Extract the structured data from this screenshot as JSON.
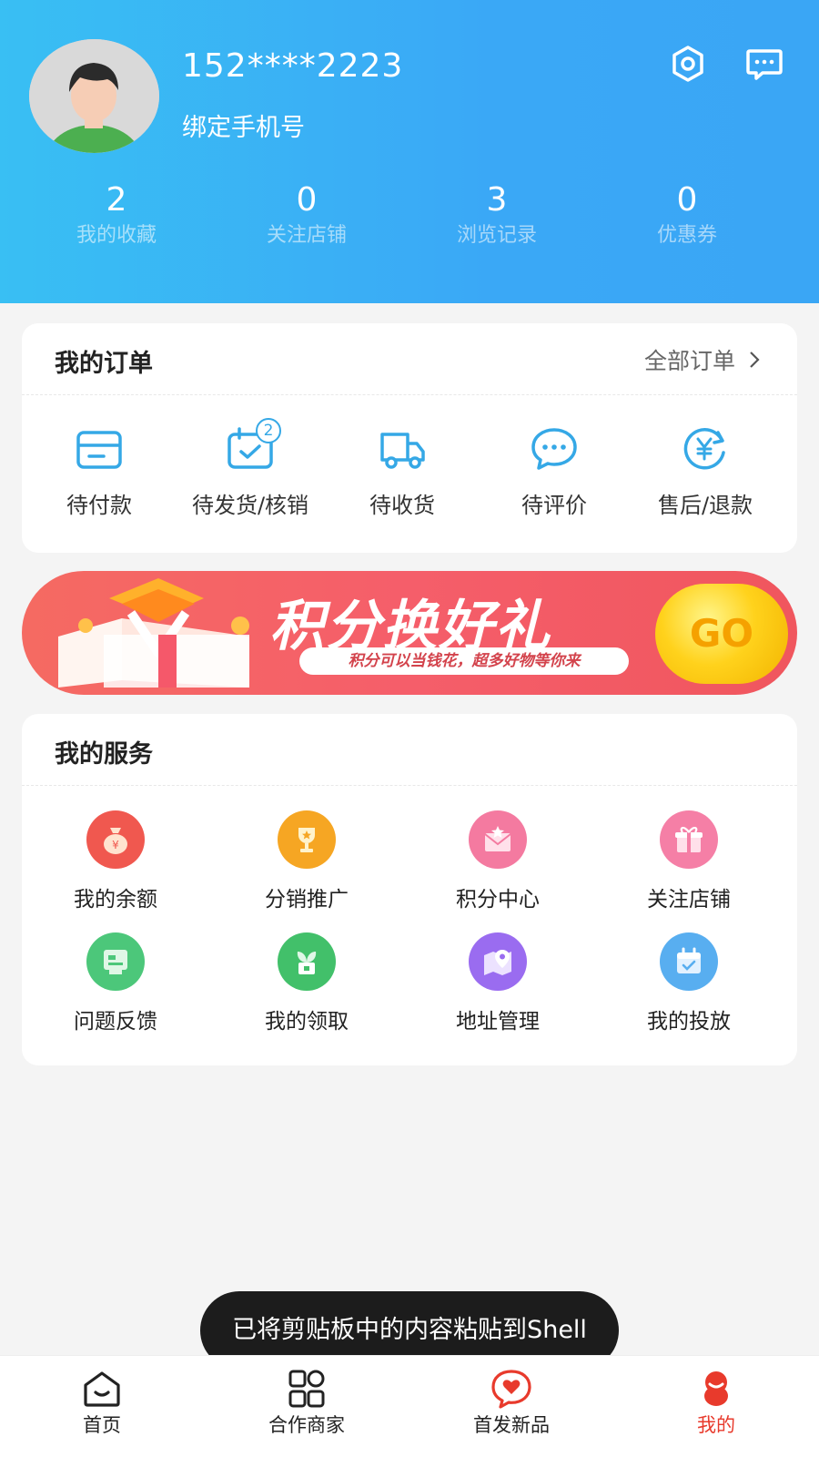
{
  "profile": {
    "phone": "152****2223",
    "bind_phone": "绑定手机号"
  },
  "header_icons": {
    "settings": "settings-icon",
    "messages": "message-icon"
  },
  "stats": [
    {
      "value": "2",
      "label": "我的收藏"
    },
    {
      "value": "0",
      "label": "关注店铺"
    },
    {
      "value": "3",
      "label": "浏览记录"
    },
    {
      "value": "0",
      "label": "优惠券"
    }
  ],
  "orders": {
    "title": "我的订单",
    "all_label": "全部订单",
    "items": [
      {
        "label": "待付款",
        "icon": "wallet-card-icon"
      },
      {
        "label": "待发货/核销",
        "icon": "calendar-check-icon",
        "badge": "2"
      },
      {
        "label": "待收货",
        "icon": "truck-icon"
      },
      {
        "label": "待评价",
        "icon": "chat-bubble-icon"
      },
      {
        "label": "售后/退款",
        "icon": "yuan-refund-icon"
      }
    ]
  },
  "banner": {
    "title": "积分换好礼",
    "subtitle": "积分可以当钱花，超多好物等你来",
    "go": "GO"
  },
  "services": {
    "title": "我的服务",
    "items": [
      {
        "label": "我的余额",
        "icon": "money-bag-icon",
        "color": "#f0584f"
      },
      {
        "label": "分销推广",
        "icon": "trophy-icon",
        "color": "#f6a623"
      },
      {
        "label": "积分中心",
        "icon": "envelope-icon",
        "color": "#f47aa0"
      },
      {
        "label": "关注店铺",
        "icon": "gift-icon",
        "color": "#f57fa6"
      },
      {
        "label": "问题反馈",
        "icon": "feedback-icon",
        "color": "#4cc77a"
      },
      {
        "label": "我的领取",
        "icon": "plant-icon",
        "color": "#42c06a"
      },
      {
        "label": "地址管理",
        "icon": "map-pin-icon",
        "color": "#9a6cf0"
      },
      {
        "label": "我的投放",
        "icon": "calendar-icon",
        "color": "#58aef0"
      }
    ]
  },
  "toast": "已将剪贴板中的内容粘贴到Shell",
  "nav": [
    {
      "label": "首页",
      "icon": "home-icon"
    },
    {
      "label": "合作商家",
      "icon": "grid-icon"
    },
    {
      "label": "首发新品",
      "icon": "heart-chat-icon"
    },
    {
      "label": "我的",
      "icon": "profile-icon",
      "active": true
    }
  ],
  "colors": {
    "header_start": "#39bff3",
    "header_end": "#3aa6f5",
    "accent_blue": "#35a8e6",
    "active_red": "#e83a2c"
  }
}
